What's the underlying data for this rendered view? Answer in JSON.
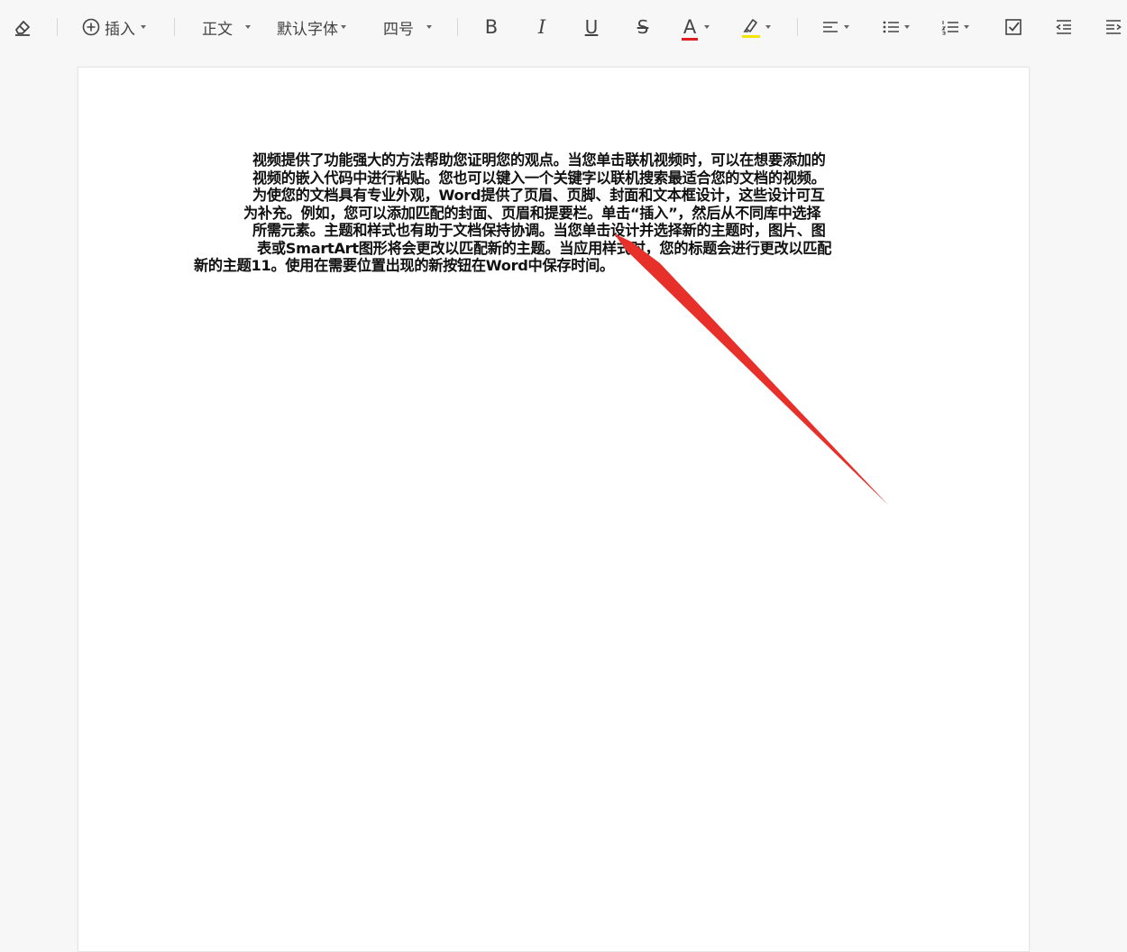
{
  "toolbar": {
    "insert_label": "插入",
    "style_label": "正文",
    "font_label": "默认字体",
    "size_label": "四号",
    "bold_label": "B",
    "italic_label": "I",
    "underline_label": "U",
    "strike_label": "S",
    "font_color_label": "A"
  },
  "colors": {
    "font_color_bar": "#e02020",
    "highlight_bar": "#f5e400",
    "arrow": "#e8302a"
  },
  "document": {
    "lines": [
      "视频提供了功能强大的方法帮助您证明您的观点。当您单击联机视频时，可以在想要添加的",
      "视频的嵌入代码中进行粘贴。您也可以键入一个关键字以联机搜索最适合您的文档的视频。",
      "为使您的文档具有专业外观，Word提供了页眉、页脚、封面和文本框设计，这些设计可互",
      "为补充。例如，您可以添加匹配的封面、页眉和提要栏。单击“插入”，然后从不同库中选择",
      "所需元素。主题和样式也有助于文档保持协调。当您单击设计并选择新的主题时，图片、图",
      "表或SmartArt图形将会更改以匹配新的主题。当应用样式时，您的标题会进行更改以匹配",
      "新的主题11。使用在需要位置出现的新按钮在Word中保存时间。"
    ]
  }
}
